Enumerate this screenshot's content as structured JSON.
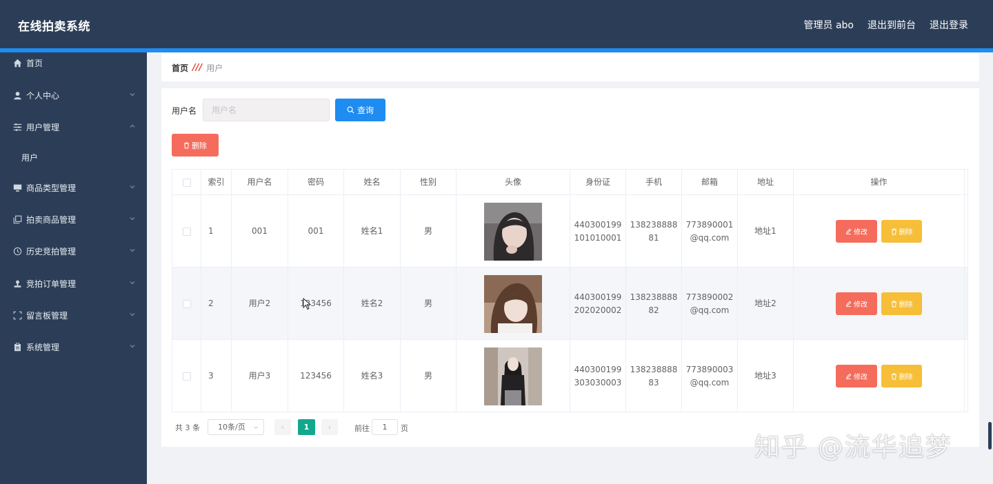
{
  "header": {
    "app_title": "在线拍卖系统",
    "admin_label": "管理员 abo",
    "back_to_front": "退出到前台",
    "logout": "退出登录"
  },
  "sidebar": {
    "items": [
      {
        "label": "首页",
        "icon": "home-icon"
      },
      {
        "label": "个人中心",
        "icon": "user-icon"
      },
      {
        "label": "用户管理",
        "icon": "sliders-icon"
      },
      {
        "label": "用户",
        "icon": ""
      },
      {
        "label": "商品类型管理",
        "icon": "monitor-icon"
      },
      {
        "label": "拍卖商品管理",
        "icon": "copy-icon"
      },
      {
        "label": "历史竞拍管理",
        "icon": "clock-icon"
      },
      {
        "label": "竞拍订单管理",
        "icon": "stamp-icon"
      },
      {
        "label": "留言板管理",
        "icon": "frame-icon"
      },
      {
        "label": "系统管理",
        "icon": "clipboard-icon"
      }
    ]
  },
  "breadcrumb": {
    "home": "首页",
    "separator": "///",
    "current": "用户"
  },
  "search": {
    "label": "用户名",
    "placeholder": "用户名",
    "query_button": "查询"
  },
  "actions": {
    "delete_button": "删除"
  },
  "table": {
    "headers": [
      "索引",
      "用户名",
      "密码",
      "姓名",
      "性别",
      "头像",
      "身份证",
      "手机",
      "邮箱",
      "地址",
      "操作"
    ],
    "rows": [
      {
        "index": "1",
        "username": "001",
        "password": "001",
        "name": "姓名1",
        "gender": "男",
        "id_line1": "440300199",
        "id_line2": "101010001",
        "phone_line1": "138238888",
        "phone_line2": "81",
        "email_line1": "773890001",
        "email_line2": "@qq.com",
        "address": "地址1"
      },
      {
        "index": "2",
        "username": "用户2",
        "password": "123456",
        "name": "姓名2",
        "gender": "男",
        "id_line1": "440300199",
        "id_line2": "202020002",
        "phone_line1": "138238888",
        "phone_line2": "82",
        "email_line1": "773890002",
        "email_line2": "@qq.com",
        "address": "地址2"
      },
      {
        "index": "3",
        "username": "用户3",
        "password": "123456",
        "name": "姓名3",
        "gender": "男",
        "id_line1": "440300199",
        "id_line2": "303030003",
        "phone_line1": "138238888",
        "phone_line2": "83",
        "email_line1": "773890003",
        "email_line2": "@qq.com",
        "address": "地址3"
      }
    ],
    "edit_label": "修改",
    "delete_label": "删除"
  },
  "pagination": {
    "total": "共 3 条",
    "page_size": "10条/页",
    "current_page": "1",
    "goto_label": "前往",
    "goto_value": "1",
    "page_suffix": "页"
  },
  "watermark": "知乎 @流华追梦",
  "colors": {
    "header_bg": "#2c3e57",
    "accent": "#1e8cf0",
    "danger": "#f56c5c",
    "warning": "#f7be38",
    "pager_active": "#13a88d"
  }
}
